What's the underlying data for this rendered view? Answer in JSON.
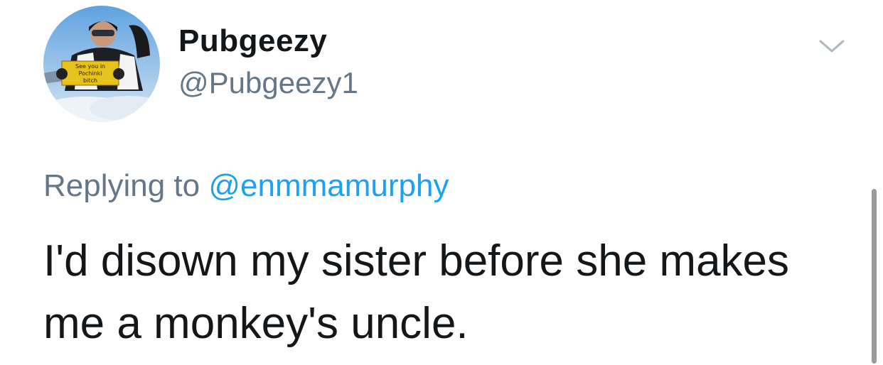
{
  "user": {
    "display_name": "Pubgeezy",
    "handle": "@Pubgeezy1",
    "avatar_sign_lines": [
      "See you in",
      "Pochinki",
      "bitch"
    ]
  },
  "reply": {
    "prefix": "Replying to ",
    "mention": "@enmmamurphy"
  },
  "tweet": {
    "text": "I'd disown my sister before she makes me a monkey's uncle."
  },
  "icons": {
    "menu": "chevron-down-icon"
  },
  "colors": {
    "text_primary": "#14171a",
    "text_secondary": "#657786",
    "link": "#1da1f2",
    "background": "#ffffff"
  }
}
